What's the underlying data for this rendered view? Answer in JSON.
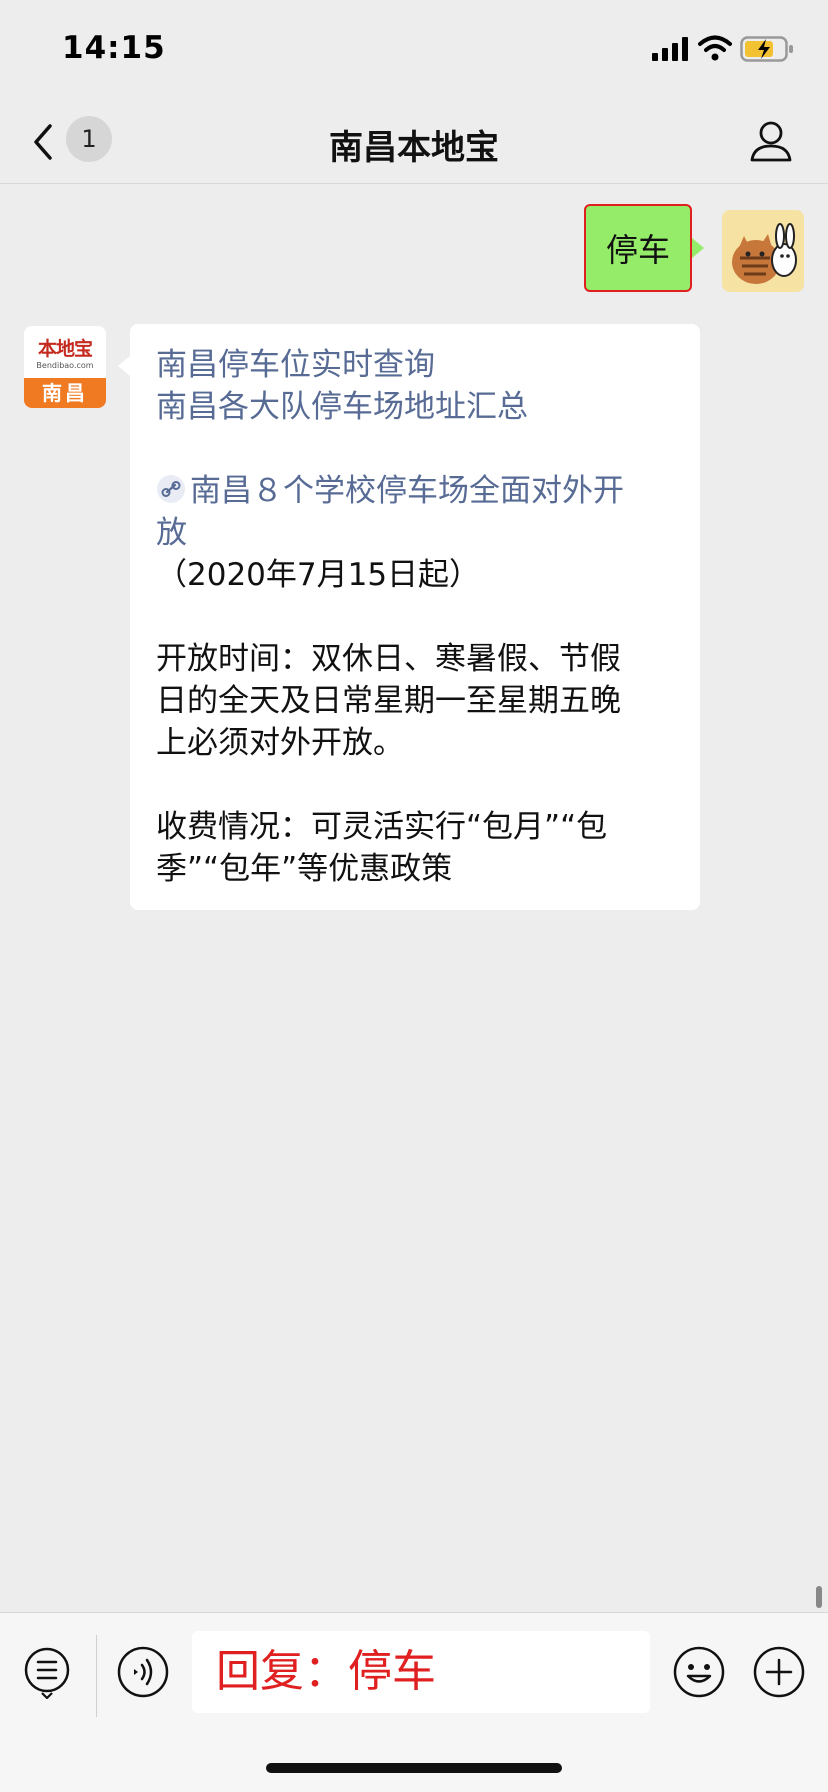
{
  "status_bar": {
    "time": "14:15"
  },
  "nav": {
    "unread_count": "1",
    "title": "南昌本地宝",
    "icons": [
      "back-chevron",
      "person-outline"
    ]
  },
  "chat": {
    "outgoing": {
      "text": "停车"
    },
    "account_avatar": {
      "logo_text": "本地宝",
      "logo_sub": "Bendibao.com",
      "city": "南昌"
    },
    "incoming": {
      "lines": [
        "南昌停车位实时查询",
        "南昌各大队停车场地址汇总"
      ],
      "link_line1": "南昌８个学校停车场全面对外开",
      "link_line2": "放",
      "date_line": "（2020年7月15日起）",
      "hours_lines": [
        "开放时间：双休日、寒暑假、节假",
        "日的全天及日常星期一至星期五晚",
        "上必须对外开放。"
      ],
      "fee_lines": [
        "收费情况：可灵活实行“包月”“包",
        "季”“包年”等优惠政策"
      ]
    }
  },
  "input_bar": {
    "text": "回复：停车",
    "icons": [
      "menu-list",
      "voice",
      "emoji",
      "plus"
    ]
  },
  "colors": {
    "background": "#ededed",
    "outgoing_bubble": "#95ec69",
    "highlight_red": "#e02020",
    "link_blue": "#576b95",
    "logo_orange": "#ef7a22"
  }
}
